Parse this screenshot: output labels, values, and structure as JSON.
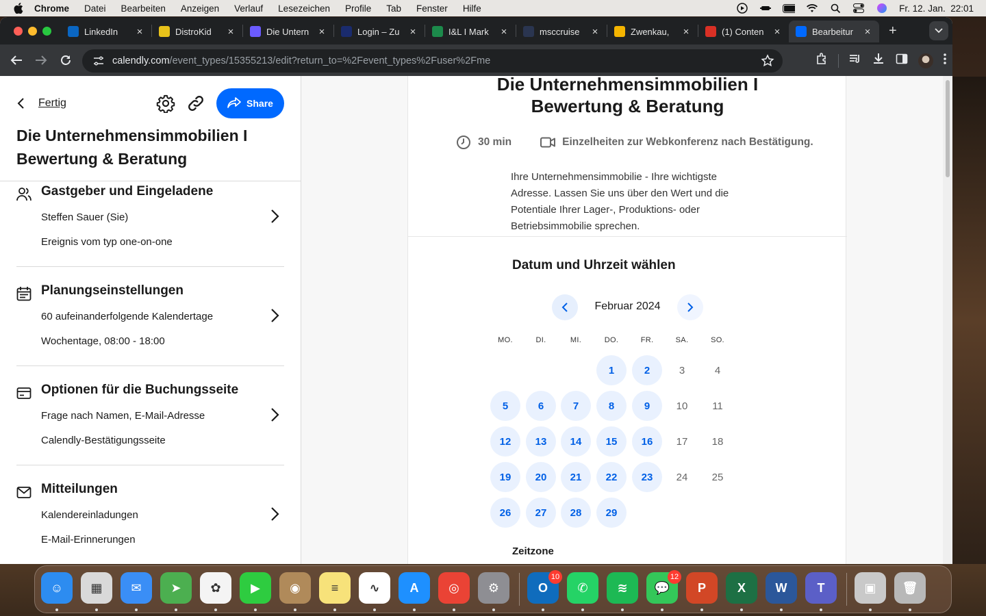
{
  "menubar": {
    "app": "Chrome",
    "items": [
      "Datei",
      "Bearbeiten",
      "Anzeigen",
      "Verlauf",
      "Lesezeichen",
      "Profile",
      "Tab",
      "Fenster",
      "Hilfe"
    ],
    "datetime": "Fr. 12. Jan.  22:01"
  },
  "tabs": [
    {
      "label": "LinkedIn",
      "icon": "linkedin-icon",
      "color": "#0a66c2"
    },
    {
      "label": "DistroKid",
      "icon": "distrokid-icon",
      "color": "#e8c21a"
    },
    {
      "label": "Die Untern",
      "icon": "calendar-app-icon",
      "color": "#6b5bff"
    },
    {
      "label": "Login – Zu",
      "icon": "login-icon",
      "color": "#1a2b6d"
    },
    {
      "label": "I&L I Mark",
      "icon": "bookmark-green-icon",
      "color": "#1c8a4b"
    },
    {
      "label": "msccruise",
      "icon": "msc-icon",
      "color": "#2a3550"
    },
    {
      "label": "Zwenkau,",
      "icon": "google-drive-icon",
      "color": "#f4b400"
    },
    {
      "label": "(1) Conten",
      "icon": "calendar-icon",
      "color": "#d93025"
    },
    {
      "label": "Bearbeitur",
      "icon": "calendly-icon",
      "color": "#0069ff",
      "active": true
    }
  ],
  "address": {
    "domain": "calendly.com",
    "path": "/event_types/15355213/edit?return_to=%2Fevent_types%2Fuser%2Fme"
  },
  "sidebar": {
    "back_label": "Fertig",
    "share_label": "Share",
    "title": "Die Unternehmensimmobilien I Bewertung & Beratung",
    "sections": [
      {
        "title": "Gastgeber und Eingeladene",
        "line1": "Steffen Sauer (Sie)",
        "line2": "Ereignis vom typ one-on-one",
        "icon": "people-icon"
      },
      {
        "title": "Planungseinstellungen",
        "line1": "60 aufeinanderfolgende Kalendertage",
        "line2": "Wochentage, 08:00 - 18:00",
        "icon": "calendar-list-icon"
      },
      {
        "title": "Optionen für die Buchungsseite",
        "line1": "Frage nach Namen, E-Mail-Adresse",
        "line2": "Calendly-Bestätigungsseite",
        "icon": "card-icon"
      },
      {
        "title": "Mitteilungen",
        "line1": "Kalendereinladungen",
        "line2": "E-Mail-Erinnerungen",
        "icon": "mail-icon"
      }
    ]
  },
  "preview": {
    "title_line1": "Die Unternehmensimmobilien I",
    "title_line2": "Bewertung & Beratung",
    "duration": "30 min",
    "conference": "Einzelheiten zur Webkonferenz nach Bestätigung.",
    "description": "Ihre Unternehmensimmobilie - Ihre wichtigste Adresse. Lassen Sie uns über den Wert und die Potentiale Ihrer Lager-, Produktions- oder Betriebsimmobilie sprechen.",
    "date_heading": "Datum und Uhrzeit wählen",
    "month": "Februar 2024",
    "weekdays": [
      "MO.",
      "DI.",
      "MI.",
      "DO.",
      "FR.",
      "SA.",
      "SO."
    ],
    "weeks": [
      [
        null,
        null,
        null,
        {
          "d": "1",
          "a": true
        },
        {
          "d": "2",
          "a": true
        },
        {
          "d": "3",
          "a": false
        },
        {
          "d": "4",
          "a": false
        }
      ],
      [
        {
          "d": "5",
          "a": true
        },
        {
          "d": "6",
          "a": true
        },
        {
          "d": "7",
          "a": true
        },
        {
          "d": "8",
          "a": true
        },
        {
          "d": "9",
          "a": true
        },
        {
          "d": "10",
          "a": false
        },
        {
          "d": "11",
          "a": false
        }
      ],
      [
        {
          "d": "12",
          "a": true
        },
        {
          "d": "13",
          "a": true
        },
        {
          "d": "14",
          "a": true
        },
        {
          "d": "15",
          "a": true
        },
        {
          "d": "16",
          "a": true
        },
        {
          "d": "17",
          "a": false
        },
        {
          "d": "18",
          "a": false
        }
      ],
      [
        {
          "d": "19",
          "a": true
        },
        {
          "d": "20",
          "a": true
        },
        {
          "d": "21",
          "a": true
        },
        {
          "d": "22",
          "a": true
        },
        {
          "d": "23",
          "a": true
        },
        {
          "d": "24",
          "a": false
        },
        {
          "d": "25",
          "a": false
        }
      ],
      [
        {
          "d": "26",
          "a": true
        },
        {
          "d": "27",
          "a": true
        },
        {
          "d": "28",
          "a": true
        },
        {
          "d": "29",
          "a": true
        },
        null,
        null,
        null
      ]
    ],
    "timezone_label": "Zeitzone"
  },
  "dock": {
    "apps": [
      {
        "name": "finder-icon",
        "color": "#2d8cf0",
        "glyph": "☺"
      },
      {
        "name": "launchpad-icon",
        "color": "#d9d9d9",
        "glyph": "▦"
      },
      {
        "name": "mail-app-icon",
        "color": "#3a8ef6",
        "glyph": "✉"
      },
      {
        "name": "maps-icon",
        "color": "#4caf50",
        "glyph": "➤"
      },
      {
        "name": "photos-icon",
        "color": "#f4f4f4",
        "glyph": "✿"
      },
      {
        "name": "facetime-icon",
        "color": "#2ecc40",
        "glyph": "▶"
      },
      {
        "name": "contacts-icon",
        "color": "#b08a5a",
        "glyph": "◉"
      },
      {
        "name": "notes-icon",
        "color": "#f7e27a",
        "glyph": "≡"
      },
      {
        "name": "freeform-icon",
        "color": "#ffffff",
        "glyph": "∿"
      },
      {
        "name": "app-store-icon",
        "color": "#1e90ff",
        "glyph": "A"
      },
      {
        "name": "chrome-icon",
        "color": "#ea4335",
        "glyph": "◎"
      },
      {
        "name": "system-settings-icon",
        "color": "#8e8e93",
        "glyph": "⚙"
      },
      {
        "name": "outlook-icon",
        "color": "#0f6cbd",
        "glyph": "O",
        "badge": "10"
      },
      {
        "name": "whatsapp-icon",
        "color": "#25d366",
        "glyph": "✆"
      },
      {
        "name": "spotify-icon",
        "color": "#1db954",
        "glyph": "≋"
      },
      {
        "name": "messages-icon",
        "color": "#34c759",
        "glyph": "💬",
        "badge": "12"
      },
      {
        "name": "powerpoint-icon",
        "color": "#d24726",
        "glyph": "P"
      },
      {
        "name": "excel-icon",
        "color": "#1d7044",
        "glyph": "X"
      },
      {
        "name": "word-icon",
        "color": "#2b579a",
        "glyph": "W"
      },
      {
        "name": "teams-icon",
        "color": "#5b5fc7",
        "glyph": "T"
      },
      {
        "name": "recent-photo-icon",
        "color": "#c9c9c9",
        "glyph": "▣"
      },
      {
        "name": "trash-icon",
        "color": "#b8b8b8",
        "glyph": "🗑"
      }
    ]
  }
}
